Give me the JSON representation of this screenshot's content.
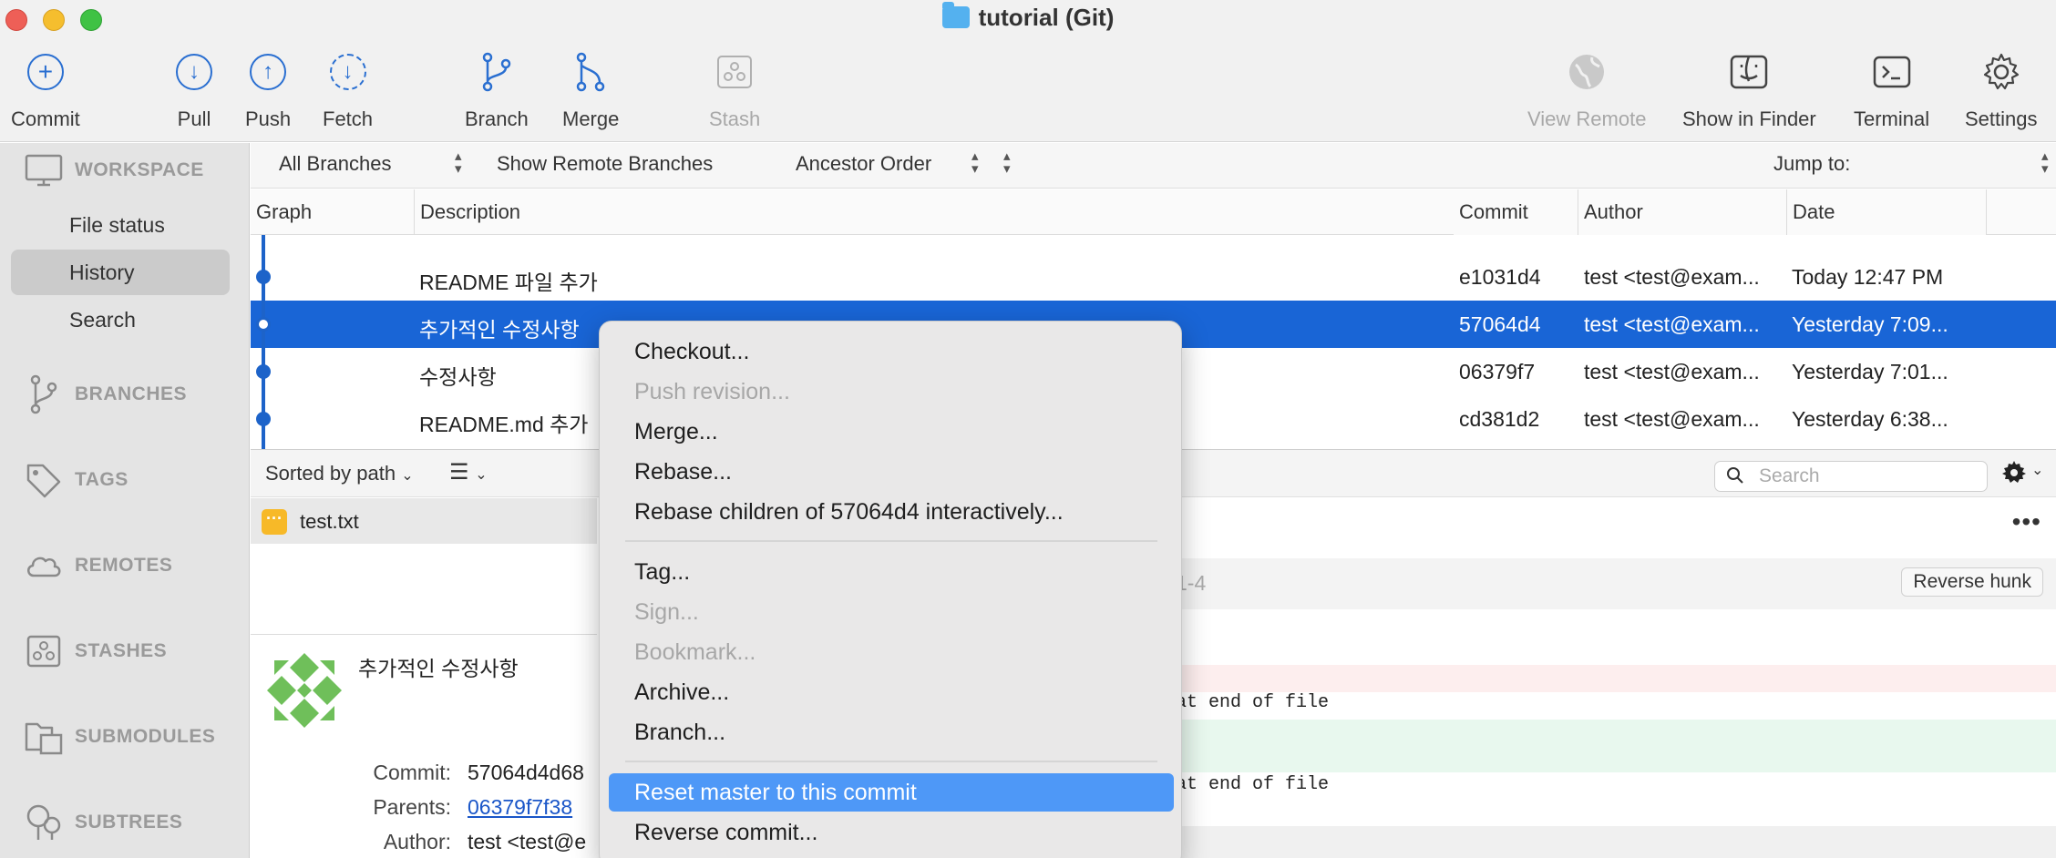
{
  "window": {
    "title": "tutorial (Git)"
  },
  "toolbar": {
    "commit": "Commit",
    "pull": "Pull",
    "push": "Push",
    "fetch": "Fetch",
    "branch": "Branch",
    "merge": "Merge",
    "stash": "Stash",
    "view_remote": "View Remote",
    "show_in_finder": "Show in Finder",
    "terminal": "Terminal",
    "settings": "Settings"
  },
  "sidebar": {
    "workspace": "WORKSPACE",
    "items": [
      "File status",
      "History",
      "Search"
    ],
    "active_item": "History",
    "branches": "BRANCHES",
    "tags": "TAGS",
    "remotes": "REMOTES",
    "stashes": "STASHES",
    "submodules": "SUBMODULES",
    "subtrees": "SUBTREES"
  },
  "filters": {
    "branches": "All Branches",
    "remote": "Show Remote Branches",
    "order": "Ancestor Order",
    "jump_to": "Jump to:"
  },
  "history": {
    "columns": [
      "Graph",
      "Description",
      "Commit",
      "Author",
      "Date"
    ],
    "rows": [
      {
        "description": "README 파일 추가",
        "commit": "e1031d4",
        "author": "test <test@exam...",
        "date": "Today 12:47 PM"
      },
      {
        "description": "추가적인 수정사항",
        "commit": "57064d4",
        "author": "test <test@exam...",
        "date": "Yesterday 7:09...",
        "selected": true
      },
      {
        "description": "수정사항",
        "commit": "06379f7",
        "author": "test <test@exam...",
        "date": "Yesterday 7:01..."
      },
      {
        "description": "README.md 추가",
        "commit": "cd381d2",
        "author": "test <test@exam...",
        "date": "Yesterday 6:38..."
      }
    ]
  },
  "files": {
    "sort": "Sorted by path",
    "search_placeholder": "Search",
    "file_name": "test.txt",
    "file_status_glyph": "···"
  },
  "commit_details": {
    "message": "추가적인 수정사항",
    "commit_label": "Commit:",
    "commit_value": "57064d4d68",
    "parents_label": "Parents:",
    "parents_value": "06379f7f38",
    "author_label": "Author:",
    "author_value": "test <test@e"
  },
  "diff": {
    "hunk_range": "1-4",
    "reverse_hunk": "Reverse hunk",
    "line_del": "at end of file",
    "line_add": "at end of file"
  },
  "context_menu": {
    "items": [
      {
        "label": "Checkout...",
        "disabled": false
      },
      {
        "label": "Push revision...",
        "disabled": true
      },
      {
        "label": "Merge...",
        "disabled": false
      },
      {
        "label": "Rebase...",
        "disabled": false
      },
      {
        "label": "Rebase children of 57064d4 interactively...",
        "disabled": false
      },
      {
        "label": "Tag...",
        "disabled": false
      },
      {
        "label": "Sign...",
        "disabled": true
      },
      {
        "label": "Bookmark...",
        "disabled": true
      },
      {
        "label": "Archive...",
        "disabled": false
      },
      {
        "label": "Branch...",
        "disabled": false
      },
      {
        "label": "Reset master to this commit",
        "disabled": false,
        "highlighted": true
      },
      {
        "label": "Reverse commit...",
        "disabled": false
      }
    ]
  },
  "colors": {
    "accent": "#1965d6",
    "menu_highlight": "#4e98f7",
    "toolbar_icon": "#2a6fd1",
    "modified_badge": "#f7b928"
  },
  "icons": {
    "commit": "plus-circle-icon",
    "pull": "arrow-down-circle-icon",
    "push": "arrow-up-circle-icon",
    "fetch": "dashed-arrow-down-circle-icon",
    "branch": "git-branch-icon",
    "merge": "git-merge-icon",
    "stash": "stash-box-icon",
    "view_remote": "globe-icon",
    "show_in_finder": "finder-icon",
    "terminal": "terminal-icon",
    "settings": "gear-icon"
  }
}
